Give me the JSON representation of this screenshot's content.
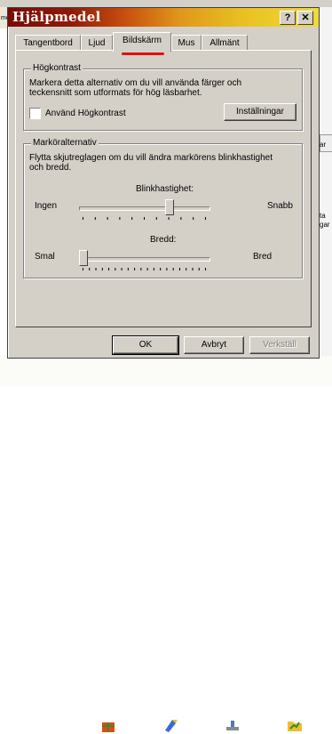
{
  "window": {
    "title": "Hjälpmedel",
    "help_button": "?",
    "close_button": "✕"
  },
  "tabs": [
    {
      "label": "Tangentbord",
      "active": false
    },
    {
      "label": "Ljud",
      "active": false
    },
    {
      "label": "Bildskärm",
      "active": true
    },
    {
      "label": "Mus",
      "active": false
    },
    {
      "label": "Allmänt",
      "active": false
    }
  ],
  "high_contrast": {
    "legend": "Högkontrast",
    "description_line1": "Markera detta alternativ om du vill använda färger och",
    "description_line2": "teckensnitt som utformats för hög läsbarhet.",
    "checkbox_label": "Använd Högkontrast",
    "checked": false,
    "settings_button": "Inställningar"
  },
  "cursor": {
    "legend": "Marköralternativ",
    "description_line1": "Flytta skjutreglagen om du vill ändra markörens blinkhastighet",
    "description_line2": "och bredd.",
    "blink": {
      "label": "Blinkhastighet:",
      "min_label": "Ingen",
      "max_label": "Snabb",
      "value_fraction": 0.7
    },
    "width": {
      "label": "Bredd:",
      "min_label": "Smal",
      "max_label": "Bred",
      "value_fraction": 0.0
    }
  },
  "footer": {
    "ok": "OK",
    "cancel": "Avbryt",
    "apply": "Verkställ"
  },
  "background": {
    "left_fragment": "me",
    "right_fragments": [
      "ar",
      "ta",
      "gar"
    ]
  }
}
